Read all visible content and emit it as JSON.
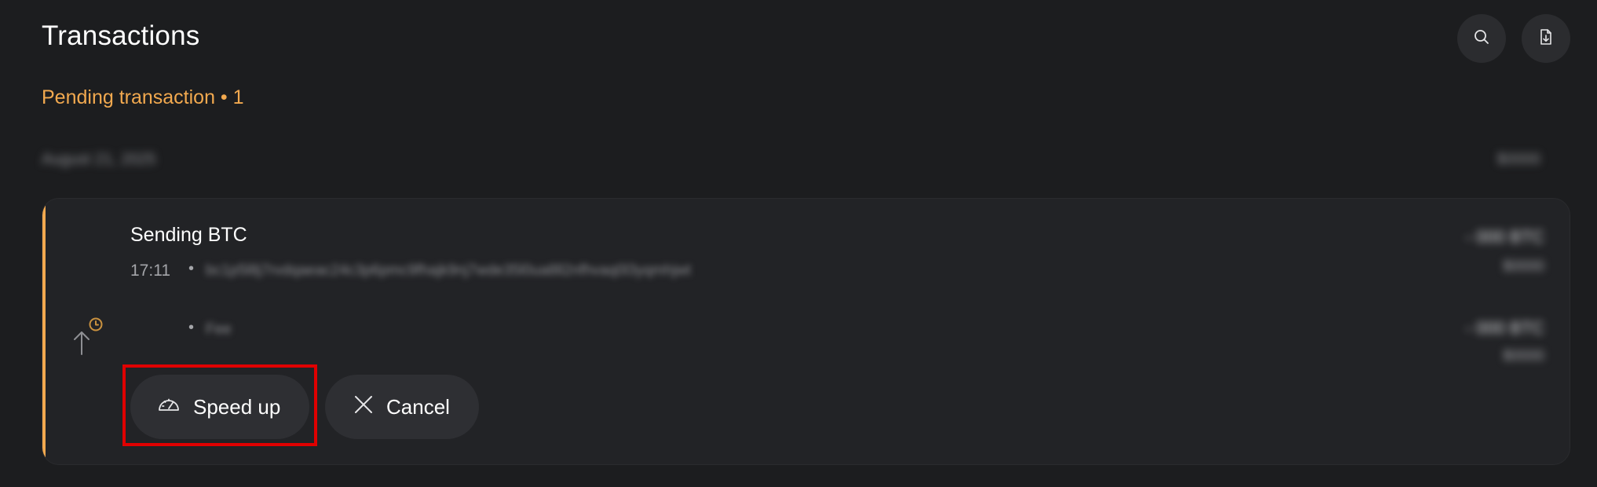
{
  "header": {
    "title": "Transactions",
    "search_icon": "search-icon",
    "export_icon": "file-download-icon"
  },
  "pending": {
    "heading": "Pending transaction • 1"
  },
  "group": {
    "date": "August 21, 2025",
    "total": "$0000"
  },
  "transaction": {
    "title": "Sending BTC",
    "time": "17:11",
    "separator": "•",
    "address": "bc1p5l8j7rvdqaeac24c3p6pmc9fhajk9nj7wde35l0ua8ll2nfhvaq0l3yqmhjwt",
    "amount_btc": "- 000 BTC",
    "amount_usd": "$0000",
    "fee_label": "Fee",
    "fee_btc": "- 000 BTC",
    "fee_usd": "$0000",
    "direction_icon": "send-pending-clock-icon",
    "accent_color": "#f2a94f"
  },
  "actions": {
    "speed_up_label": "Speed up",
    "speed_up_icon": "speedometer-icon",
    "cancel_label": "Cancel",
    "cancel_icon": "close-icon"
  },
  "colors": {
    "background": "#1c1d1f",
    "card": "#222326",
    "accent": "#f2a94f",
    "highlight": "#e00000"
  }
}
